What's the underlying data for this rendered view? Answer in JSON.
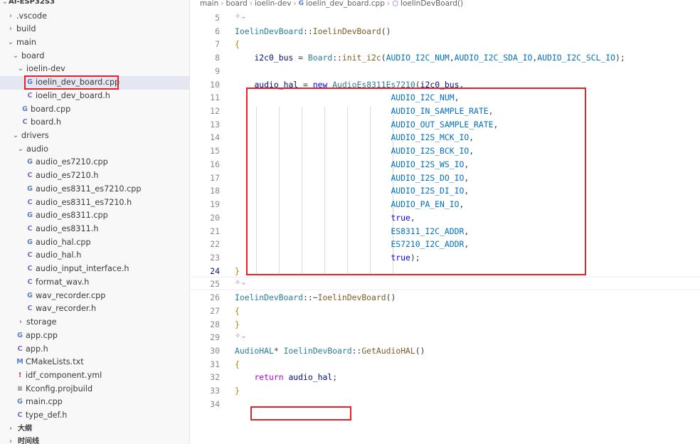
{
  "sidebar": {
    "project": "AI-ESP32S3",
    "items": [
      {
        "label": ".vscode",
        "type": "folder",
        "depth": 1,
        "expanded": false
      },
      {
        "label": "build",
        "type": "folder",
        "depth": 1,
        "expanded": false
      },
      {
        "label": "main",
        "type": "folder",
        "depth": 1,
        "expanded": true
      },
      {
        "label": "board",
        "type": "folder",
        "depth": 2,
        "expanded": true
      },
      {
        "label": "ioelin-dev",
        "type": "folder",
        "depth": 3,
        "expanded": true
      },
      {
        "label": "ioelin_dev_board.cpp",
        "type": "cpp",
        "depth": 4,
        "selected": true
      },
      {
        "label": "ioelin_dev_board.h",
        "type": "h",
        "depth": 4
      },
      {
        "label": "board.cpp",
        "type": "cpp",
        "depth": 3
      },
      {
        "label": "board.h",
        "type": "h",
        "depth": 3
      },
      {
        "label": "drivers",
        "type": "folder",
        "depth": 2,
        "expanded": true
      },
      {
        "label": "audio",
        "type": "folder",
        "depth": 3,
        "expanded": true
      },
      {
        "label": "audio_es7210.cpp",
        "type": "cpp",
        "depth": 4
      },
      {
        "label": "audio_es7210.h",
        "type": "h",
        "depth": 4
      },
      {
        "label": "audio_es8311_es7210.cpp",
        "type": "cpp",
        "depth": 4
      },
      {
        "label": "audio_es8311_es7210.h",
        "type": "h",
        "depth": 4
      },
      {
        "label": "audio_es8311.cpp",
        "type": "cpp",
        "depth": 4
      },
      {
        "label": "audio_es8311.h",
        "type": "h",
        "depth": 4
      },
      {
        "label": "audio_hal.cpp",
        "type": "cpp",
        "depth": 4
      },
      {
        "label": "audio_hal.h",
        "type": "h",
        "depth": 4
      },
      {
        "label": "audio_input_interface.h",
        "type": "h",
        "depth": 4
      },
      {
        "label": "format_wav.h",
        "type": "h",
        "depth": 4
      },
      {
        "label": "wav_recorder.cpp",
        "type": "cpp",
        "depth": 4
      },
      {
        "label": "wav_recorder.h",
        "type": "h",
        "depth": 4
      },
      {
        "label": "storage",
        "type": "folder",
        "depth": 3,
        "expanded": false
      },
      {
        "label": "app.cpp",
        "type": "cpp",
        "depth": 2
      },
      {
        "label": "app.h",
        "type": "h",
        "depth": 2
      },
      {
        "label": "CMakeLists.txt",
        "type": "cmake",
        "depth": 2
      },
      {
        "label": "idf_component.yml",
        "type": "yml",
        "depth": 2
      },
      {
        "label": "Kconfig.projbuild",
        "type": "kconfig",
        "depth": 2
      },
      {
        "label": "main.cpp",
        "type": "cpp",
        "depth": 2
      },
      {
        "label": "type_def.h",
        "type": "h",
        "depth": 2
      }
    ],
    "sections": [
      "大纲",
      "时间线"
    ]
  },
  "breadcrumb": [
    "main",
    "board",
    "ioelin-dev",
    "ioelin_dev_board.cpp",
    "IoelinDevBoard()"
  ],
  "icons": {
    "folder_collapsed": "chevron-right-icon",
    "folder_expanded": "chevron-down-icon",
    "cpp_file": "cpp-file-icon",
    "h_file": "c-header-file-icon",
    "cmake_file": "cmake-file-icon",
    "yml_file": "yaml-file-icon",
    "kconfig_file": "kconfig-file-icon",
    "symbol": "method-symbol-icon",
    "codelens": "sparkle-chevron-icon"
  },
  "editor": {
    "active_line": "24",
    "codelens_glyph": "✧⌄",
    "lines": [
      {
        "num": "5",
        "tokens": []
      },
      {
        "num": "6",
        "lens": true,
        "tokens": [
          [
            "t-type",
            "IoelinDevBoard"
          ],
          [
            "t-punc",
            "::"
          ],
          [
            "t-fn",
            "IoelinDevBoard"
          ],
          [
            "t-punc",
            "()"
          ]
        ]
      },
      {
        "num": "7",
        "tokens": [
          [
            "t-brace",
            "{"
          ]
        ]
      },
      {
        "num": "8",
        "tokens": [
          [
            "t-punc",
            "    "
          ],
          [
            "t-var",
            "i2c0_bus"
          ],
          [
            "t-punc",
            " = "
          ],
          [
            "t-type",
            "Board"
          ],
          [
            "t-punc",
            "::"
          ],
          [
            "t-fn",
            "init_i2c"
          ],
          [
            "t-punc",
            "("
          ],
          [
            "t-enum",
            "AUDIO_I2C_NUM"
          ],
          [
            "t-punc",
            ","
          ],
          [
            "t-enum",
            "AUDIO_I2C_SDA_IO"
          ],
          [
            "t-punc",
            ","
          ],
          [
            "t-enum",
            "AUDIO_I2C_SCL_IO"
          ],
          [
            "t-punc",
            ");"
          ]
        ]
      },
      {
        "num": "9",
        "tokens": []
      },
      {
        "num": "10",
        "tokens": [
          [
            "t-punc",
            "    "
          ],
          [
            "t-var",
            "audio_hal"
          ],
          [
            "t-punc",
            " = "
          ],
          [
            "t-kw",
            "new"
          ],
          [
            "t-punc",
            " "
          ],
          [
            "t-type",
            "AudioEs8311Es7210"
          ],
          [
            "t-punc",
            "("
          ],
          [
            "t-var",
            "i2c0_bus"
          ],
          [
            "t-punc",
            ","
          ]
        ]
      },
      {
        "num": "11",
        "tokens": [
          [
            "t-punc",
            "                                "
          ],
          [
            "t-enum",
            "AUDIO_I2C_NUM"
          ],
          [
            "t-punc",
            ","
          ]
        ]
      },
      {
        "num": "12",
        "tokens": [
          [
            "t-punc",
            "                                "
          ],
          [
            "t-enum",
            "AUDIO_IN_SAMPLE_RATE"
          ],
          [
            "t-punc",
            ","
          ]
        ]
      },
      {
        "num": "13",
        "tokens": [
          [
            "t-punc",
            "                                "
          ],
          [
            "t-enum",
            "AUDIO_OUT_SAMPLE_RATE"
          ],
          [
            "t-punc",
            ","
          ]
        ]
      },
      {
        "num": "14",
        "tokens": [
          [
            "t-punc",
            "                                "
          ],
          [
            "t-enum",
            "AUDIO_I2S_MCK_IO"
          ],
          [
            "t-punc",
            ","
          ]
        ]
      },
      {
        "num": "15",
        "tokens": [
          [
            "t-punc",
            "                                "
          ],
          [
            "t-enum",
            "AUDIO_I2S_BCK_IO"
          ],
          [
            "t-punc",
            ","
          ]
        ]
      },
      {
        "num": "16",
        "tokens": [
          [
            "t-punc",
            "                                "
          ],
          [
            "t-enum",
            "AUDIO_I2S_WS_IO"
          ],
          [
            "t-punc",
            ","
          ]
        ]
      },
      {
        "num": "17",
        "tokens": [
          [
            "t-punc",
            "                                "
          ],
          [
            "t-enum",
            "AUDIO_I2S_DO_IO"
          ],
          [
            "t-punc",
            ","
          ]
        ]
      },
      {
        "num": "18",
        "tokens": [
          [
            "t-punc",
            "                                "
          ],
          [
            "t-enum",
            "AUDIO_I2S_DI_IO"
          ],
          [
            "t-punc",
            ","
          ]
        ]
      },
      {
        "num": "19",
        "tokens": [
          [
            "t-punc",
            "                                "
          ],
          [
            "t-enum",
            "AUDIO_PA_EN_IO"
          ],
          [
            "t-punc",
            ","
          ]
        ]
      },
      {
        "num": "20",
        "tokens": [
          [
            "t-punc",
            "                                "
          ],
          [
            "t-kw",
            "true"
          ],
          [
            "t-punc",
            ","
          ]
        ]
      },
      {
        "num": "21",
        "tokens": [
          [
            "t-punc",
            "                                "
          ],
          [
            "t-enum",
            "ES8311_I2C_ADDR"
          ],
          [
            "t-punc",
            ","
          ]
        ]
      },
      {
        "num": "22",
        "tokens": [
          [
            "t-punc",
            "                                "
          ],
          [
            "t-enum",
            "ES7210_I2C_ADDR"
          ],
          [
            "t-punc",
            ","
          ]
        ]
      },
      {
        "num": "23",
        "tokens": [
          [
            "t-punc",
            "                                "
          ],
          [
            "t-kw",
            "true"
          ],
          [
            "t-punc",
            ");"
          ]
        ]
      },
      {
        "num": "24",
        "tokens": [
          [
            "t-brace",
            "}"
          ]
        ]
      },
      {
        "num": "25",
        "tokens": []
      },
      {
        "num": "26",
        "lens": true,
        "tokens": [
          [
            "t-type",
            "IoelinDevBoard"
          ],
          [
            "t-punc",
            "::~"
          ],
          [
            "t-fn",
            "IoelinDevBoard"
          ],
          [
            "t-punc",
            "()"
          ]
        ]
      },
      {
        "num": "27",
        "tokens": [
          [
            "t-brace",
            "{"
          ]
        ]
      },
      {
        "num": "28",
        "tokens": [
          [
            "t-brace",
            "}"
          ]
        ]
      },
      {
        "num": "29",
        "tokens": []
      },
      {
        "num": "30",
        "lens": true,
        "tokens": [
          [
            "t-type",
            "AudioHAL"
          ],
          [
            "t-punc",
            "* "
          ],
          [
            "t-type",
            "IoelinDevBoard"
          ],
          [
            "t-punc",
            "::"
          ],
          [
            "t-fn",
            "GetAudioHAL"
          ],
          [
            "t-punc",
            "()"
          ]
        ]
      },
      {
        "num": "31",
        "tokens": [
          [
            "t-brace",
            "{"
          ]
        ]
      },
      {
        "num": "32",
        "tokens": [
          [
            "t-punc",
            "    "
          ],
          [
            "t-ctl",
            "return"
          ],
          [
            "t-punc",
            " "
          ],
          [
            "t-var",
            "audio_hal"
          ],
          [
            "t-punc",
            ";"
          ]
        ]
      },
      {
        "num": "33",
        "tokens": [
          [
            "t-brace",
            "}"
          ]
        ]
      },
      {
        "num": "34",
        "tokens": []
      }
    ]
  }
}
